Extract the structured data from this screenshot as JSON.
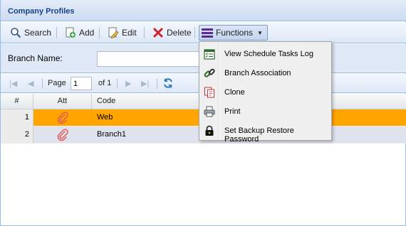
{
  "panel": {
    "title": "Company Profiles"
  },
  "toolbar": {
    "search_label": "Search",
    "add_label": "Add",
    "edit_label": "Edit",
    "delete_label": "Delete",
    "functions_label": "Functions"
  },
  "filter": {
    "branch_label": "Branch Name:",
    "branch_value": ""
  },
  "pager": {
    "page_label": "Page",
    "page_value": "1",
    "of_label": "of 1"
  },
  "grid": {
    "columns": [
      "#",
      "Att",
      "Code"
    ],
    "rows": [
      {
        "num": "1",
        "code": "Web",
        "selected": true
      },
      {
        "num": "2",
        "code": "Branch1",
        "selected": false
      }
    ]
  },
  "menu": {
    "items": [
      {
        "label": "View Schedule Tasks Log",
        "icon": "schedule-log-icon"
      },
      {
        "label": "Branch Association",
        "icon": "chain-link-icon"
      },
      {
        "label": "Clone",
        "icon": "clone-document-icon"
      },
      {
        "label": "Print",
        "icon": "printer-icon"
      },
      {
        "label": "Set Backup Restore Password",
        "icon": "padlock-icon"
      }
    ]
  },
  "colors": {
    "selected_row": "#ffa500",
    "header_text": "#15428b",
    "functions_icon": "#5b2b8f"
  }
}
